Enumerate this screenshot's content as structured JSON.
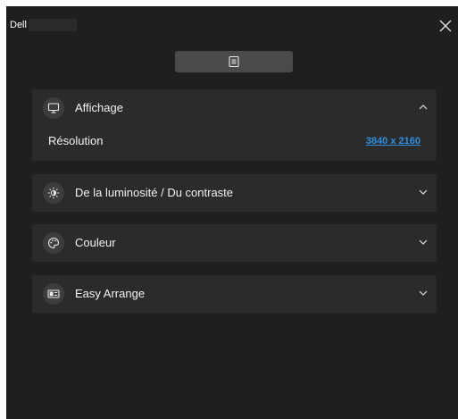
{
  "app": {
    "title": "Dell",
    "model_name": ""
  },
  "toolbar": {
    "menu_icon": "menu-list-icon"
  },
  "sections": [
    {
      "label": "Affichage",
      "icon": "monitor-icon",
      "expanded": true,
      "rows": [
        {
          "label": "Résolution",
          "value": "3840 x 2160"
        }
      ]
    },
    {
      "label": "De la luminosité / Du contraste",
      "icon": "brightness-icon",
      "expanded": false
    },
    {
      "label": "Couleur",
      "icon": "palette-icon",
      "expanded": false
    },
    {
      "label": "Easy Arrange",
      "icon": "easy-arrange-icon",
      "expanded": false
    }
  ],
  "colors": {
    "background": "#1f1f1f",
    "panel": "#2b2b2b",
    "link": "#2e8fe0",
    "toolbar_button": "#4a4a4a"
  }
}
